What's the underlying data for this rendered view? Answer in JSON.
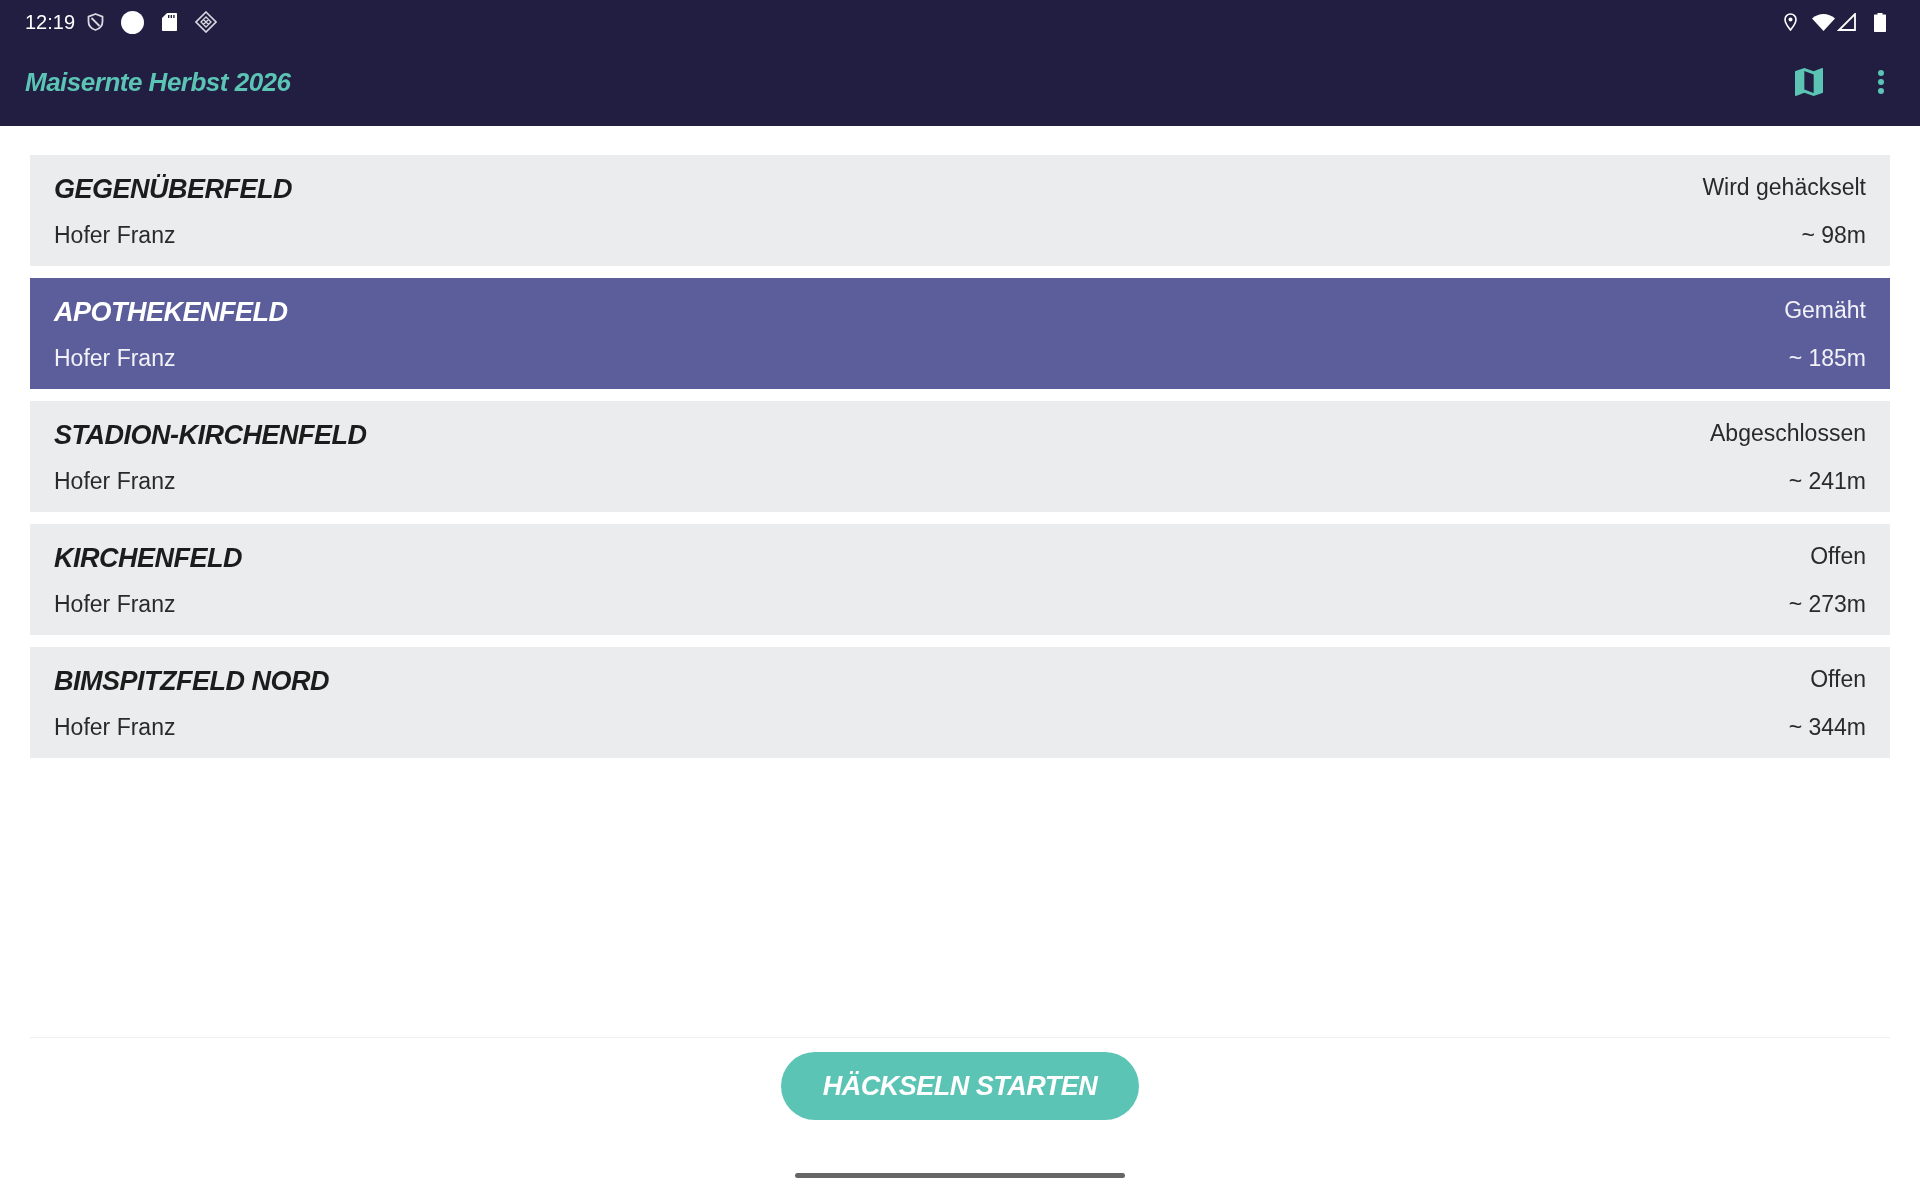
{
  "status_bar": {
    "time": "12:19"
  },
  "app_bar": {
    "title": "Maisernte Herbst 2026"
  },
  "fields": [
    {
      "name": "GEGENÜBERFELD",
      "owner": "Hofer Franz",
      "status": "Wird gehäckselt",
      "distance": "~ 98m",
      "selected": false
    },
    {
      "name": "APOTHEKENFELD",
      "owner": "Hofer Franz",
      "status": "Gemäht",
      "distance": "~ 185m",
      "selected": true
    },
    {
      "name": "STADION-KIRCHENFELD",
      "owner": "Hofer Franz",
      "status": "Abgeschlossen",
      "distance": "~ 241m",
      "selected": false
    },
    {
      "name": "KIRCHENFELD",
      "owner": "Hofer Franz",
      "status": "Offen",
      "distance": "~ 273m",
      "selected": false
    },
    {
      "name": "BIMSPITZFELD NORD",
      "owner": "Hofer Franz",
      "status": "Offen",
      "distance": "~ 344m",
      "selected": false
    }
  ],
  "primary_button": {
    "label": "HÄCKSELN STARTEN"
  }
}
